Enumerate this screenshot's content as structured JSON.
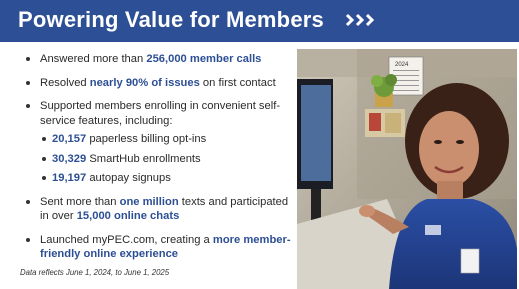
{
  "banner": {
    "title": "Powering Value for Members"
  },
  "bullets": [
    {
      "pre": "Answered more than ",
      "hl": "256,000 member calls",
      "post": ""
    },
    {
      "pre": "Resolved ",
      "hl": "nearly 90% of issues",
      "post": " on first contact"
    },
    {
      "text": "Supported members enrolling in convenient self-service features, including:"
    }
  ],
  "sub_bullets": [
    {
      "hl": "20,157",
      "post": " paperless billing opt-ins"
    },
    {
      "hl": "30,329",
      "post": " SmartHub enrollments"
    },
    {
      "hl": "19,197",
      "post": " autopay signups"
    }
  ],
  "bullets2": [
    {
      "pre": "Sent more than ",
      "hl": "one million",
      "mid": " texts and participated in over ",
      "hl2": "15,000 online chats"
    },
    {
      "pre": "Launched myPEC.com, creating a ",
      "hl": "more member-friendly online experience"
    }
  ],
  "footnote": "Data reflects June 1, 2024, to June 1, 2025",
  "photo": {
    "calendar_year": "2024"
  },
  "colors": {
    "brand_blue": "#2d4f95"
  }
}
